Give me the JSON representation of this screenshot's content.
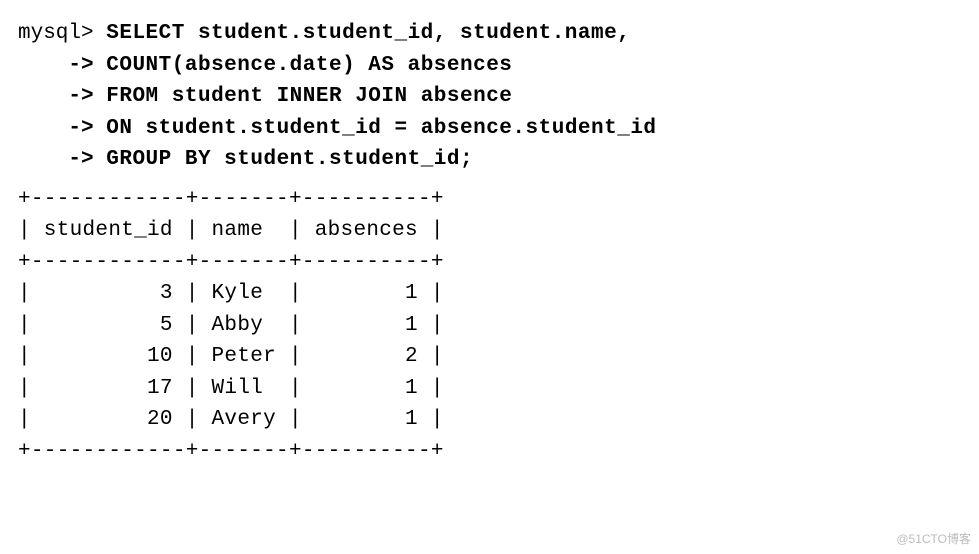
{
  "query": {
    "prompt": "mysql>",
    "cont": "->",
    "lines": [
      "SELECT student.student_id, student.name,",
      "COUNT(absence.date) AS absences",
      "FROM student INNER JOIN absence",
      "ON student.student_id = absence.student_id",
      "GROUP BY student.student_id;"
    ]
  },
  "result": {
    "border_top": "+------------+-------+----------+",
    "header": "| student_id | name  | absences |",
    "border_mid": "+------------+-------+----------+",
    "rows": [
      "|          3 | Kyle  |        1 |",
      "|          5 | Abby  |        1 |",
      "|         10 | Peter |        2 |",
      "|         17 | Will  |        1 |",
      "|         20 | Avery |        1 |"
    ],
    "border_bot": "+------------+-------+----------+"
  },
  "chart_data": {
    "type": "table",
    "columns": [
      "student_id",
      "name",
      "absences"
    ],
    "rows": [
      {
        "student_id": 3,
        "name": "Kyle",
        "absences": 1
      },
      {
        "student_id": 5,
        "name": "Abby",
        "absences": 1
      },
      {
        "student_id": 10,
        "name": "Peter",
        "absences": 2
      },
      {
        "student_id": 17,
        "name": "Will",
        "absences": 1
      },
      {
        "student_id": 20,
        "name": "Avery",
        "absences": 1
      }
    ]
  },
  "watermark": "@51CTO博客"
}
